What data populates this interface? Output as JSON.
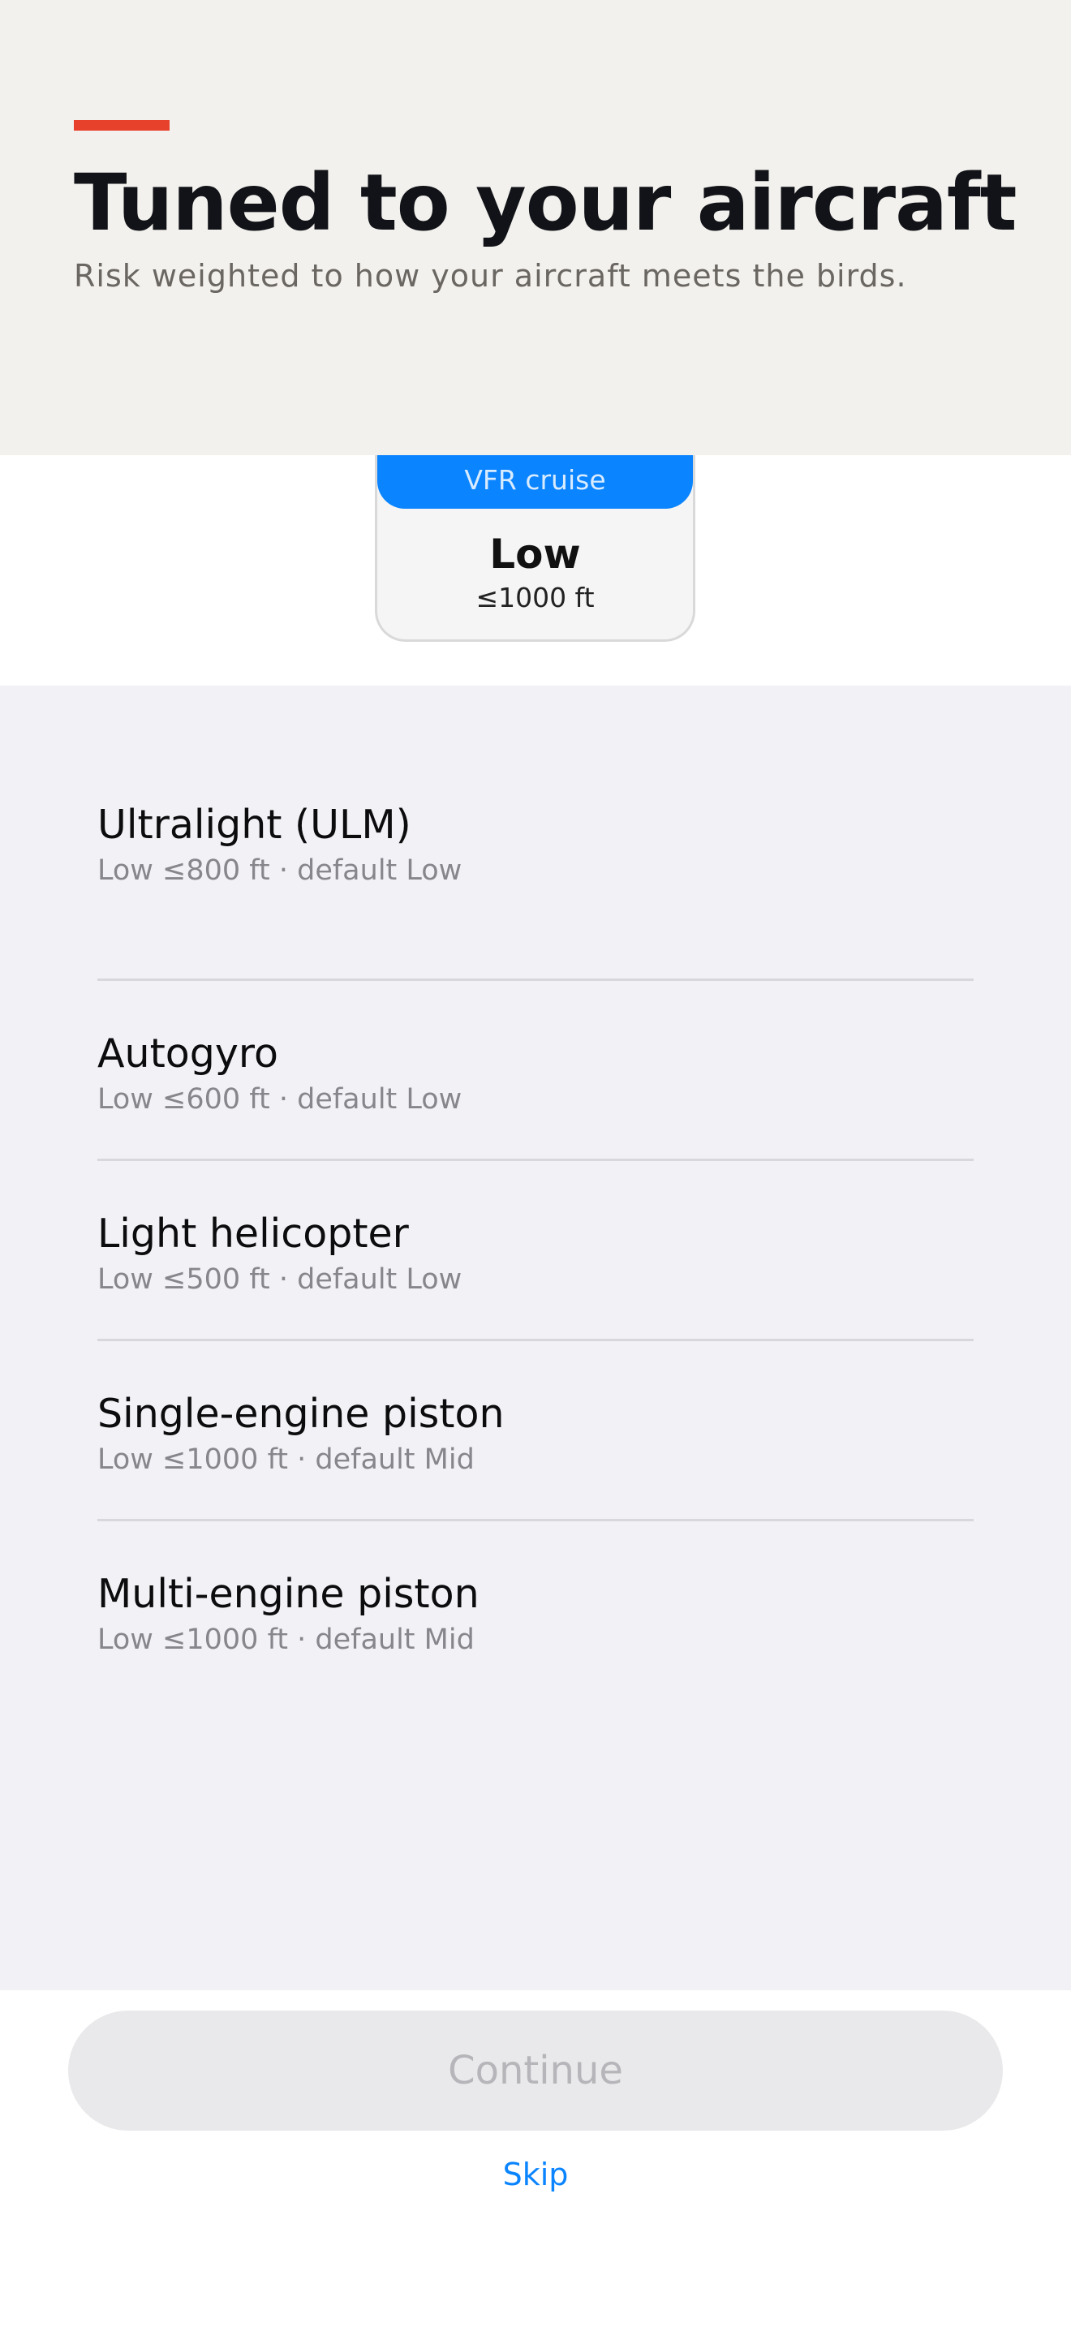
{
  "header": {
    "title": "Tuned to your aircraft",
    "subtitle": "Risk weighted to how your aircraft meets the birds.",
    "accent_color": "#e8412b"
  },
  "altitude_card": {
    "chip_label": "VFR cruise",
    "level": "Low",
    "range": "≤1000 ft",
    "chip_color": "#0a84ff"
  },
  "aircraft": [
    {
      "name": "Ultralight (ULM)",
      "detail": "Low ≤800 ft · default Low"
    },
    {
      "name": "Autogyro",
      "detail": "Low ≤600 ft · default Low"
    },
    {
      "name": "Light helicopter",
      "detail": "Low ≤500 ft · default Low"
    },
    {
      "name": "Single-engine piston",
      "detail": "Low ≤1000 ft · default Mid"
    },
    {
      "name": "Multi-engine piston",
      "detail": "Low ≤1000 ft · default Mid"
    }
  ],
  "footer": {
    "continue_label": "Continue",
    "skip_label": "Skip",
    "link_color": "#0a84ff"
  }
}
